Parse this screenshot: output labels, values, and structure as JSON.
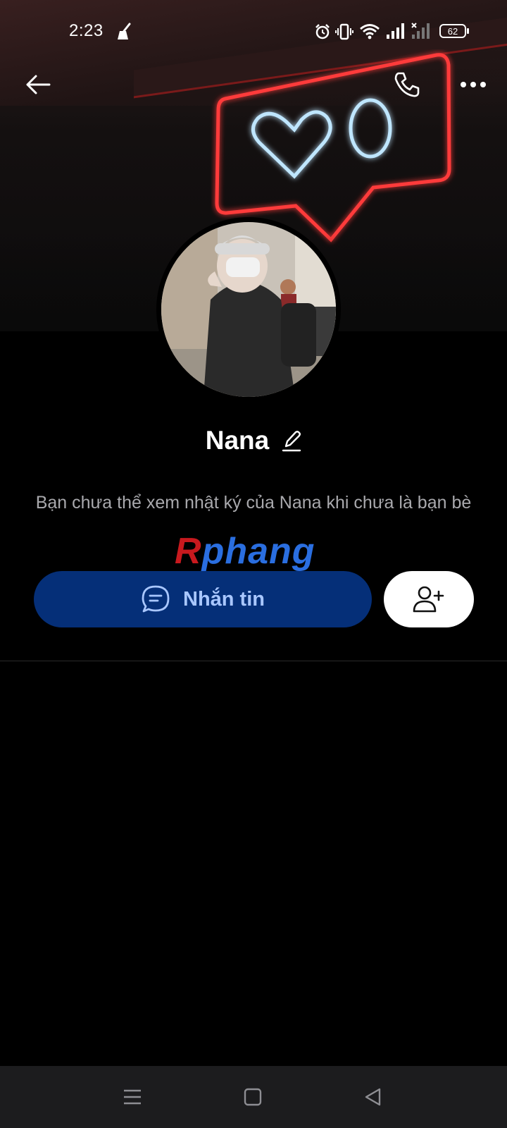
{
  "status_bar": {
    "time": "2:23",
    "battery": "62",
    "icons": [
      "broom-icon",
      "alarm-icon",
      "vibrate-icon",
      "wifi-icon",
      "signal-icon",
      "signal-no-sim-icon",
      "battery-icon"
    ]
  },
  "header": {
    "back_icon": "arrow-left-icon",
    "call_icon": "phone-icon",
    "more_icon": "more-horizontal-icon"
  },
  "profile": {
    "name": "Nana",
    "edit_icon": "pencil-icon",
    "notice": "Bạn chưa thể xem nhật ký của Nana khi chưa là bạn bè"
  },
  "watermark": {
    "first_letter": "R",
    "rest": "phang"
  },
  "actions": {
    "message_label": "Nhắn tin",
    "message_icon": "chat-bubble-icon",
    "add_friend_icon": "user-plus-icon"
  },
  "colors": {
    "message_button_bg": "#052f78",
    "message_button_text": "#a9c7ff",
    "background": "#000000",
    "notice_text": "#a9a9ad"
  },
  "navigation": {
    "icons": [
      "menu-icon",
      "home-square-icon",
      "back-triangle-icon"
    ]
  }
}
